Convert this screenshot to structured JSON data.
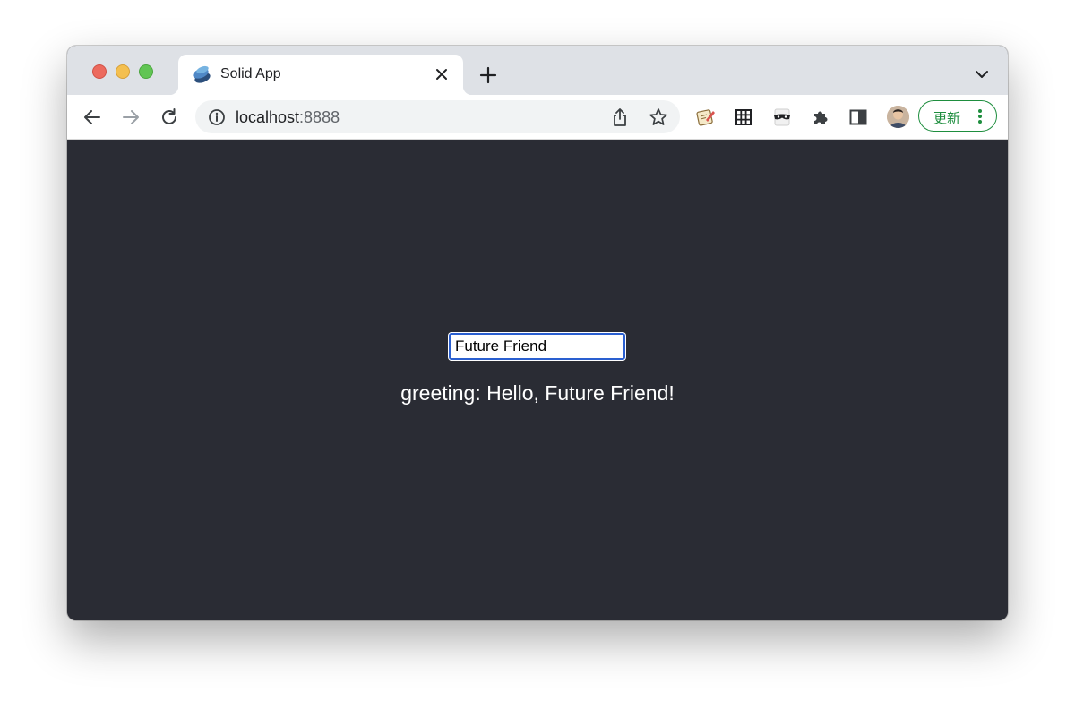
{
  "browser": {
    "tab": {
      "title": "Solid App"
    },
    "address_bar": {
      "host": "localhost",
      "port": ":8888"
    },
    "update_button": {
      "label": "更新"
    },
    "extensions": [
      "script-editor-icon",
      "grid-icon",
      "incognito-mask-icon",
      "puzzle-icon",
      "side-panel-icon"
    ]
  },
  "page": {
    "name_input": {
      "value": "Future Friend"
    },
    "greeting": {
      "text": "greeting: Hello, Future Friend!"
    }
  },
  "colors": {
    "page_background": "#2a2c34",
    "tabstrip": "#dee1e6",
    "accent_green": "#1e8e3e",
    "input_focus": "#2a5fd0"
  }
}
